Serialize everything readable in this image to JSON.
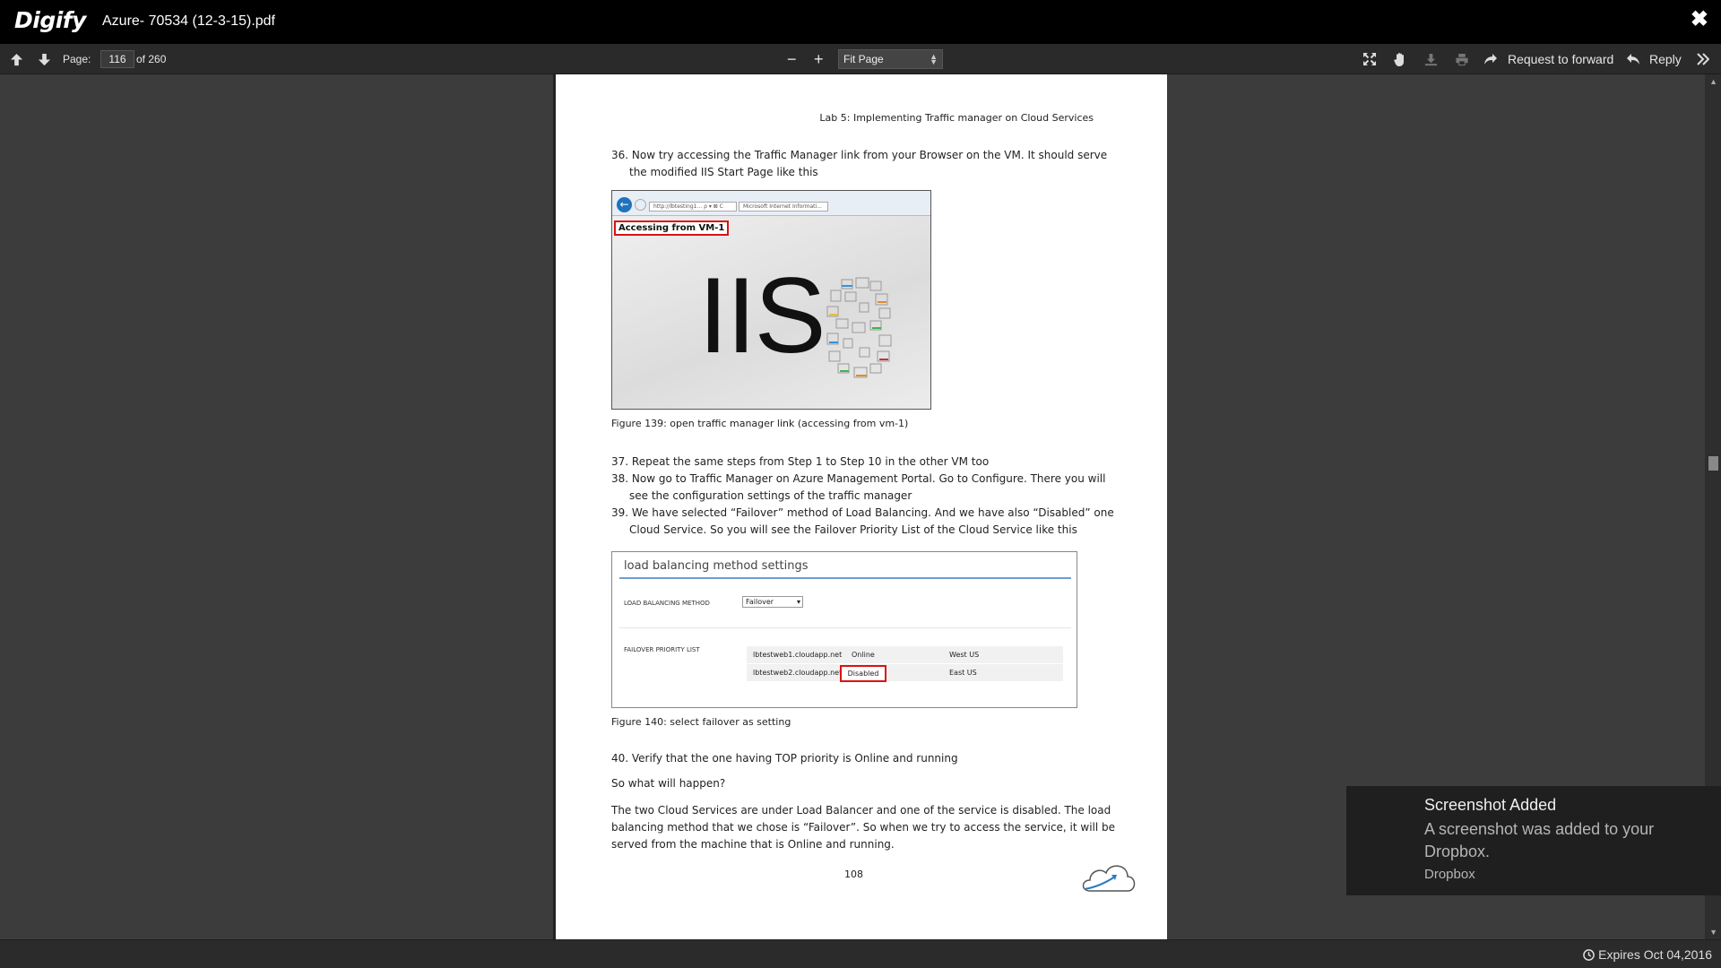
{
  "app": {
    "logo": "Digify",
    "document_title": "Azure- 70534 (12-3-15).pdf"
  },
  "toolbar": {
    "page_label": "Page:",
    "current_page": "116",
    "of_total": "of 260",
    "zoom_minus": "−",
    "zoom_plus": "+",
    "zoom_mode": "Fit Page",
    "request_forward": "Request to forward",
    "reply": "Reply"
  },
  "page": {
    "header": "Lab 5: Implementing Traffic manager on Cloud Services",
    "step36_line1": "36. Now try accessing the Traffic Manager link from your Browser on the VM. It should serve",
    "step36_line2": "the modified IIS Start Page like this",
    "fig139": {
      "url_text": "http://lbtesting1... ρ ▾ ⊠ C",
      "tab_text": "Microsoft Internet Informati... ×",
      "vm_label": "Accessing from VM-1",
      "logo_text": "IIS",
      "caption": "Figure 139: open traffic manager link (accessing from vm-1)"
    },
    "step37": "37. Repeat the same steps from Step 1 to Step 10 in the other VM too",
    "step38_line1": "38. Now go to Traffic Manager on Azure Management Portal. Go to Configure. There you will",
    "step38_line2": "see the configuration settings of the traffic manager",
    "step39_line1": "39. We have selected “Failover” method of Load Balancing. And we have also “Disabled” one",
    "step39_line2": "Cloud Service. So you will see the Failover Priority List of the Cloud Service like this",
    "fig140": {
      "title": "load balancing method settings",
      "method_label": "LOAD BALANCING METHOD",
      "method_value": "Failover",
      "priority_label": "FAILOVER PRIORITY LIST",
      "rows": [
        {
          "host": "lbtestweb1.cloudapp.net",
          "status": "Online",
          "region": "West US"
        },
        {
          "host": "lbtestweb2.cloudapp.net",
          "status": "Disabled",
          "region": "East US"
        }
      ],
      "caption": "Figure 140: select failover as setting"
    },
    "step40": "40. Verify that the one having TOP priority is Online and running",
    "question": "So what will happen?",
    "para_line1": "The two Cloud Services are under Load Balancer and one of the service is disabled. The load",
    "para_line2": "balancing method that we chose is “Failover”. So when we try to access the service, it will be",
    "para_line3": "served from the machine that is Online and running.",
    "page_number": "108"
  },
  "status": {
    "expires": "Expires Oct 04,2016"
  },
  "toast": {
    "title": "Screenshot Added",
    "message": "A screenshot was added to your Dropbox.",
    "source": "Dropbox"
  }
}
